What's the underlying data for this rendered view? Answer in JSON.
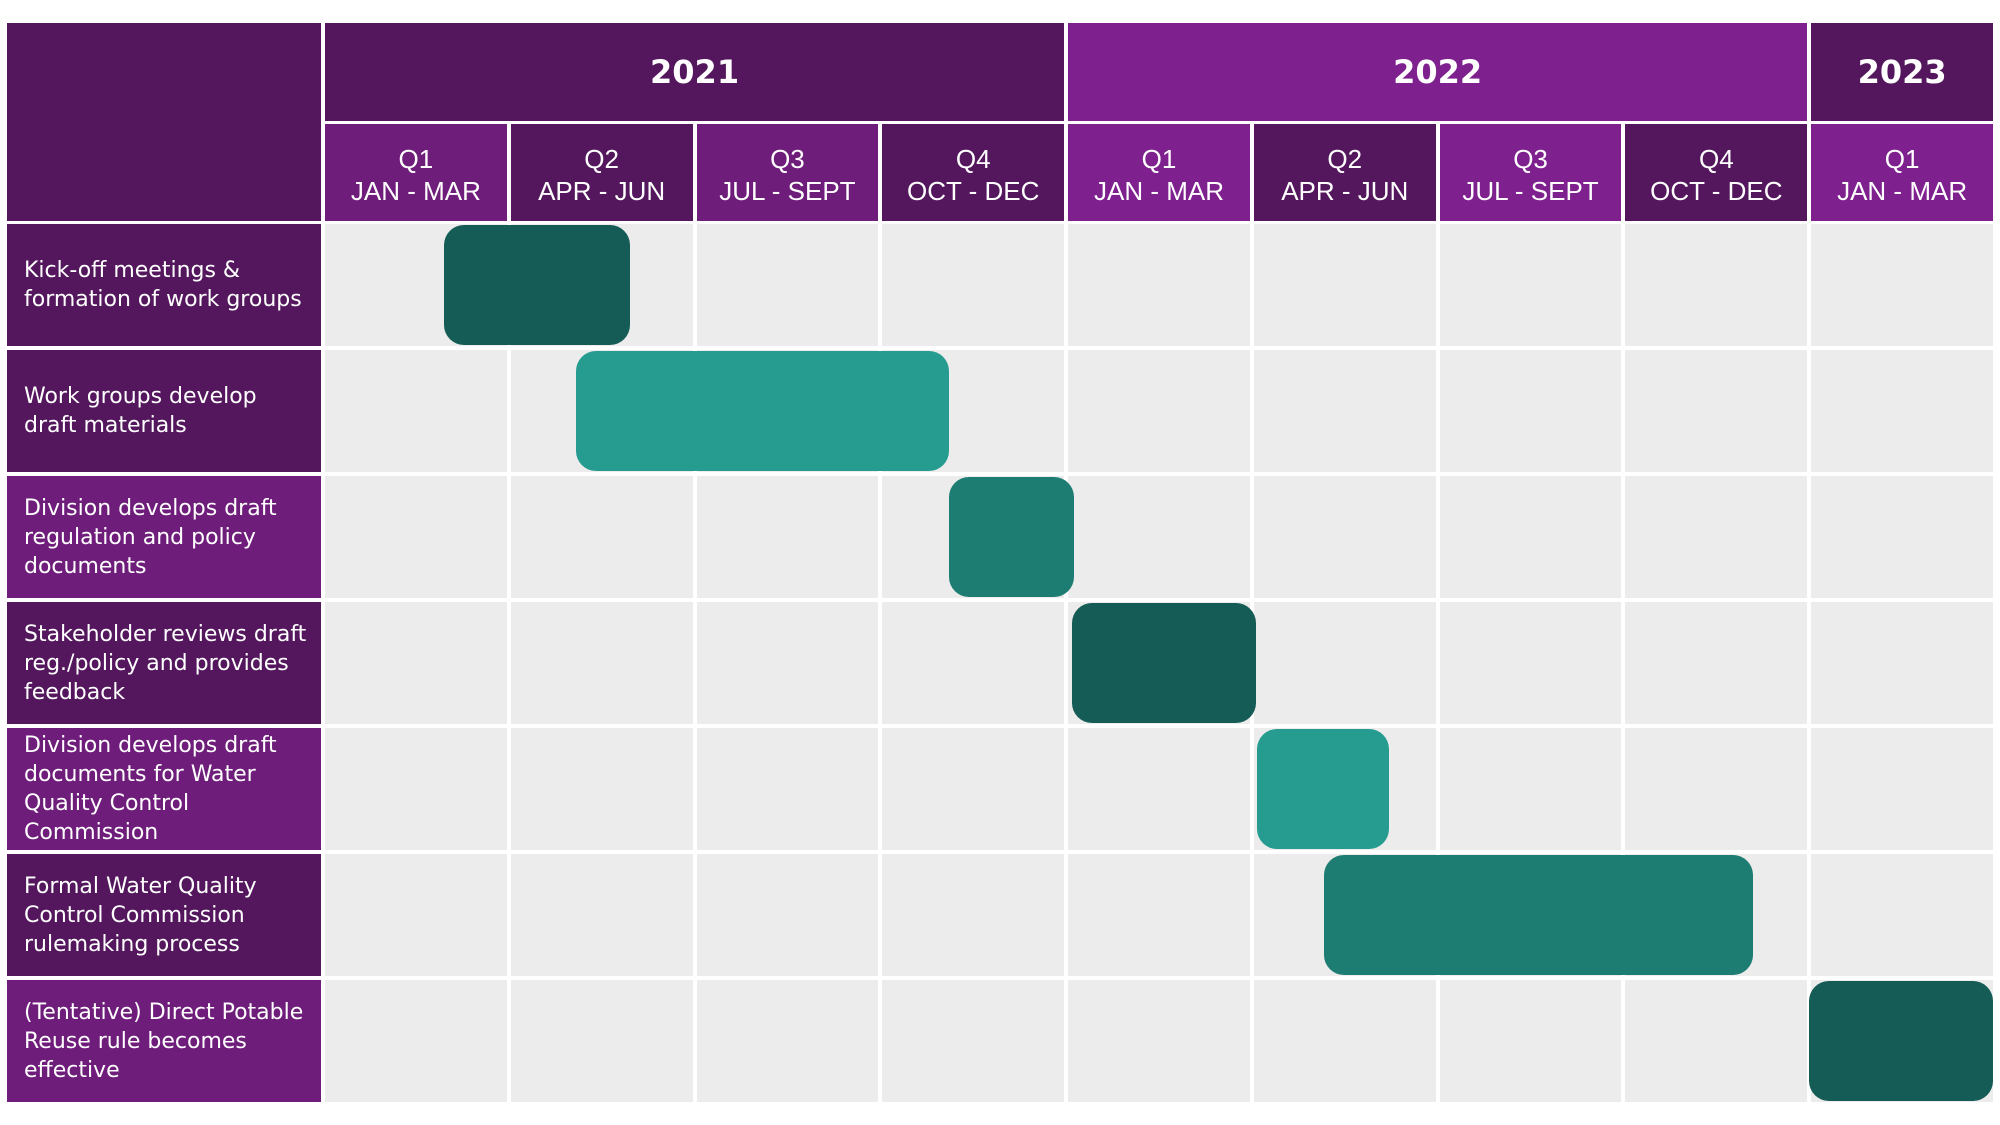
{
  "colors": {
    "header_dark": "#54175e",
    "header_mid": "#6f1d7b",
    "header_bright": "#7e208e",
    "grid_background": "#ececec",
    "bar_dark": "#165c56",
    "bar_medium": "#1e7d72",
    "bar_light": "#269c90"
  },
  "chart_data": {
    "type": "gantt",
    "title": "",
    "time_unit": "quarter",
    "years": [
      {
        "label": "2021",
        "quarters": 4,
        "color": "#54175e"
      },
      {
        "label": "2022",
        "quarters": 4,
        "color": "#7e208e"
      },
      {
        "label": "2023",
        "quarters": 1,
        "color": "#54175e"
      }
    ],
    "quarters": [
      {
        "q": "Q1",
        "months": "JAN - MAR",
        "year": "2021",
        "color": "#6f1d7b"
      },
      {
        "q": "Q2",
        "months": "APR - JUN",
        "year": "2021",
        "color": "#54175e"
      },
      {
        "q": "Q3",
        "months": "JUL - SEPT",
        "year": "2021",
        "color": "#6f1d7b"
      },
      {
        "q": "Q4",
        "months": "OCT - DEC",
        "year": "2021",
        "color": "#54175e"
      },
      {
        "q": "Q1",
        "months": "JAN - MAR",
        "year": "2022",
        "color": "#7e208e"
      },
      {
        "q": "Q2",
        "months": "APR - JUN",
        "year": "2022",
        "color": "#54175e"
      },
      {
        "q": "Q3",
        "months": "JUL - SEPT",
        "year": "2022",
        "color": "#7e208e"
      },
      {
        "q": "Q4",
        "months": "OCT - DEC",
        "year": "2022",
        "color": "#54175e"
      },
      {
        "q": "Q1",
        "months": "JAN - MAR",
        "year": "2023",
        "color": "#7e208e"
      }
    ],
    "tasks": [
      {
        "label": "Kick-off meetings & formation of work groups",
        "label_color": "#54175e",
        "start": 0.65,
        "end": 1.65,
        "bar_color": "#165c56"
      },
      {
        "label": "Work groups develop draft materials",
        "label_color": "#54175e",
        "start": 1.36,
        "end": 3.37,
        "bar_color": "#269c90"
      },
      {
        "label": "Division develops draft regulation and policy documents",
        "label_color": "#6f1d7b",
        "start": 3.37,
        "end": 4.04,
        "bar_color": "#1e7d72"
      },
      {
        "label": "Stakeholder reviews draft reg./policy and provides feedback",
        "label_color": "#54175e",
        "start": 4.03,
        "end": 5.02,
        "bar_color": "#165c56"
      },
      {
        "label": "Division develops draft documents for Water Quality Control Commission",
        "label_color": "#6f1d7b",
        "start": 5.03,
        "end": 5.74,
        "bar_color": "#269c90"
      },
      {
        "label": "Formal Water Quality Control Commission rulemaking process",
        "label_color": "#54175e",
        "start": 5.39,
        "end": 7.7,
        "bar_color": "#1e7d72"
      },
      {
        "label": "(Tentative) Direct Potable Reuse rule becomes effective",
        "label_color": "#6f1d7b",
        "start": 8.0,
        "end": 9.0,
        "bar_color": "#165c56"
      }
    ],
    "x_range_quarters": [
      0,
      9
    ]
  }
}
